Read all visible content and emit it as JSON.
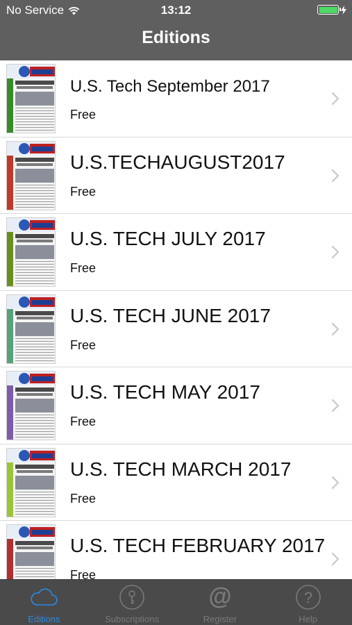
{
  "status_bar": {
    "carrier": "No Service",
    "time": "13:12"
  },
  "nav": {
    "title": "Editions"
  },
  "editions": [
    {
      "title": "U.S. Tech September 2017",
      "price": "Free",
      "accent": "#3a8a2a"
    },
    {
      "title": "U.S.TECHAUGUST2017",
      "price": "Free",
      "accent": "#c0392b"
    },
    {
      "title": "U.S. TECH JULY 2017",
      "price": "Free",
      "accent": "#6b8e23"
    },
    {
      "title": "U.S. TECH JUNE 2017",
      "price": "Free",
      "accent": "#5aa07a"
    },
    {
      "title": "U.S. TECH MAY 2017",
      "price": "Free",
      "accent": "#7b5ea7"
    },
    {
      "title": "U.S. TECH MARCH 2017",
      "price": "Free",
      "accent": "#9cc43a"
    },
    {
      "title": "U.S. TECH FEBRUARY 2017",
      "price": "Free",
      "accent": "#b03030"
    }
  ],
  "tabs": [
    {
      "label": "Editions",
      "icon": "cloud-icon",
      "active": true
    },
    {
      "label": "Subscriptions",
      "icon": "key-icon",
      "active": false
    },
    {
      "label": "Register",
      "icon": "at-sign-icon",
      "active": false
    },
    {
      "label": "Help",
      "icon": "question-icon",
      "active": false
    }
  ],
  "colors": {
    "nav_background": "#5f5f5f",
    "tab_background": "#4a4a4a",
    "tab_active": "#2a8ae8",
    "tab_inactive": "#7a7a7a",
    "battery": "#4cd964"
  }
}
